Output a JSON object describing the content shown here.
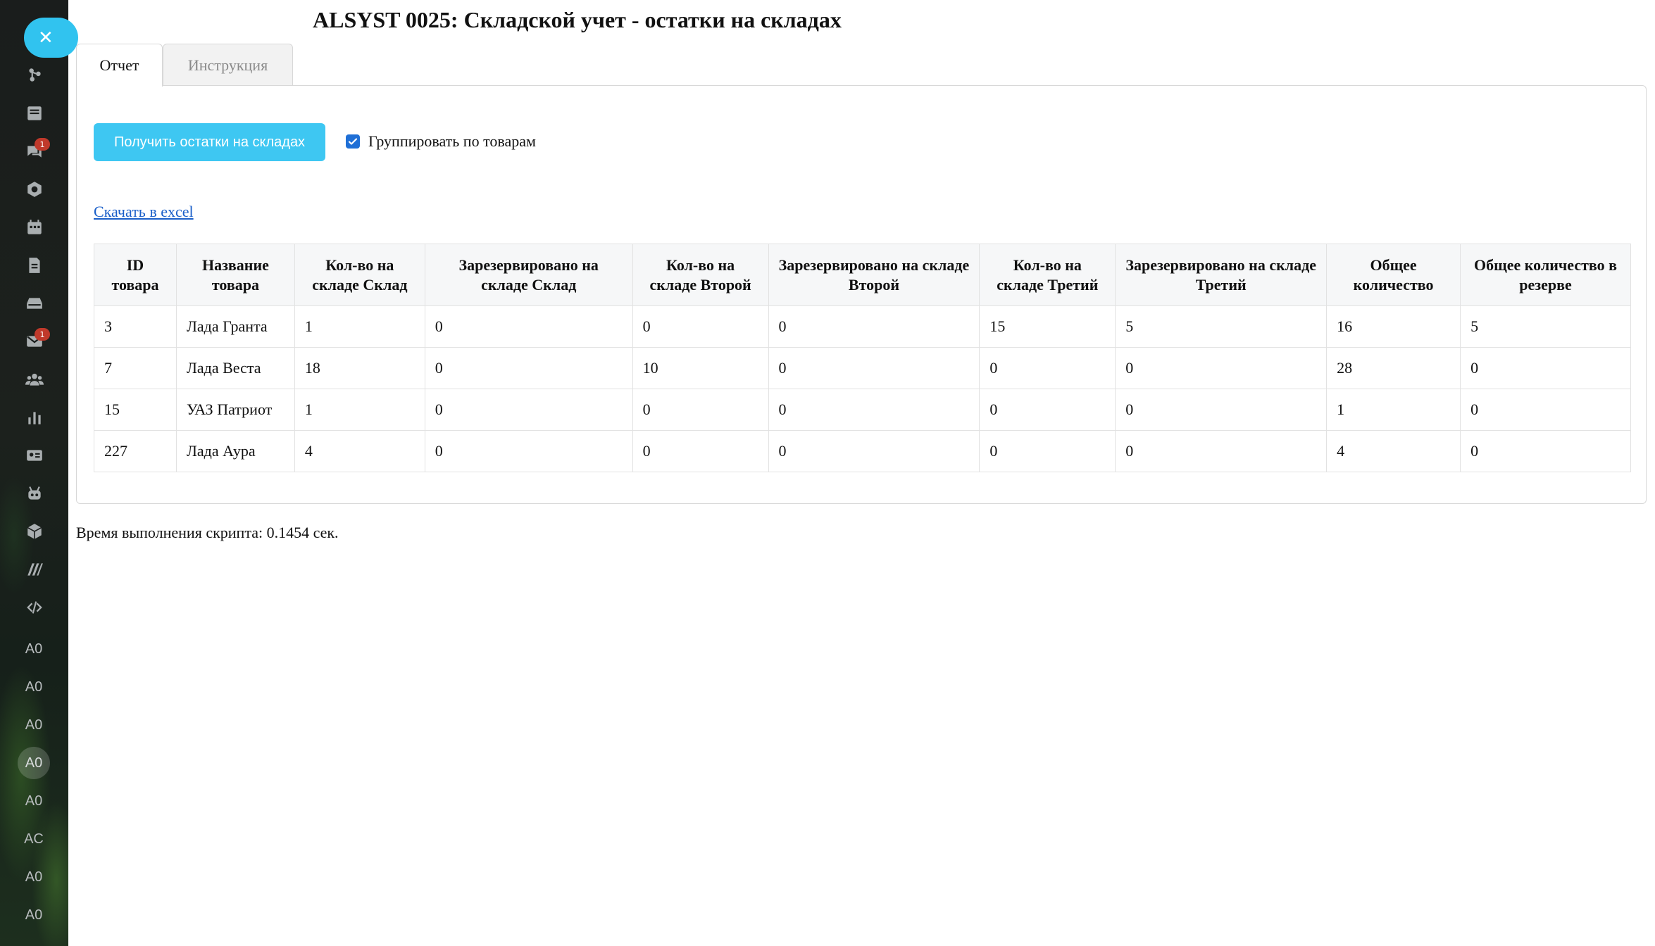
{
  "page": {
    "title": "ALSYST 0025: Складской учет - остатки на складах"
  },
  "tabs": [
    {
      "label": "Отчет",
      "active": true
    },
    {
      "label": "Инструкция",
      "active": false
    }
  ],
  "actions": {
    "get_button_label": "Получить остатки на складах",
    "group_checkbox_label": "Группировать по товарам",
    "group_checked": true,
    "excel_link_label": "Скачать в excel"
  },
  "table": {
    "headers": [
      "ID товара",
      "Название товара",
      "Кол-во на складе Склад",
      "Зарезервировано на складе Склад",
      "Кол-во на складе Второй",
      "Зарезервировано на складе Второй",
      "Кол-во на складе Третий",
      "Зарезервировано на складе Третий",
      "Общее количество",
      "Общее количество в резерве"
    ],
    "rows": [
      [
        "3",
        "Лада Гранта",
        "1",
        "0",
        "0",
        "0",
        "15",
        "5",
        "16",
        "5"
      ],
      [
        "7",
        "Лада Веста",
        "18",
        "0",
        "10",
        "0",
        "0",
        "0",
        "28",
        "0"
      ],
      [
        "15",
        "УАЗ Патриот",
        "1",
        "0",
        "0",
        "0",
        "0",
        "0",
        "1",
        "0"
      ],
      [
        "227",
        "Лада Аура",
        "4",
        "0",
        "0",
        "0",
        "0",
        "0",
        "4",
        "0"
      ]
    ]
  },
  "footer": {
    "exec_time": "Время выполнения скрипта: 0.1454 сек."
  },
  "sidebar": {
    "icons": [
      {
        "name": "network-icon"
      },
      {
        "name": "news-icon"
      },
      {
        "name": "chat-icon",
        "badge": "1"
      },
      {
        "name": "hexagon-icon"
      },
      {
        "name": "calendar-icon"
      },
      {
        "name": "document-icon"
      },
      {
        "name": "drive-icon"
      },
      {
        "name": "mail-icon",
        "badge": "1"
      },
      {
        "name": "users-icon"
      },
      {
        "name": "chart-icon"
      },
      {
        "name": "id-card-icon"
      },
      {
        "name": "robot-icon"
      },
      {
        "name": "box-icon"
      },
      {
        "name": "marketplace-icon"
      },
      {
        "name": "code-icon"
      }
    ],
    "text_items": [
      "A0",
      "A0",
      "A0",
      "A0",
      "A0",
      "AC",
      "A0",
      "A0"
    ],
    "active_text_index": 3
  },
  "colors": {
    "accent": "#3ec7f2",
    "link": "#1a5fc9",
    "checkbox": "#1f6fd6",
    "badge": "#c0392b"
  }
}
